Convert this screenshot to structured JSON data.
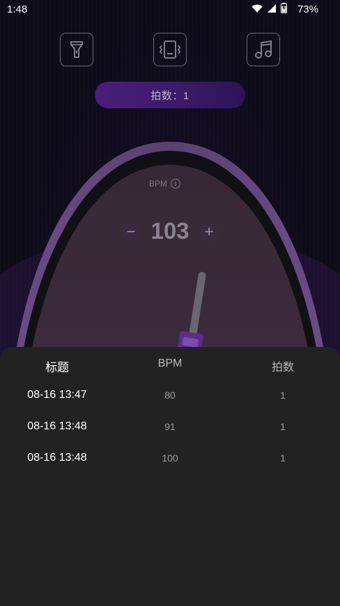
{
  "status_bar": {
    "time": "1:48",
    "battery": "73%",
    "icons": [
      "wifi-icon",
      "signal-icon",
      "battery-icon"
    ]
  },
  "toolbar": {
    "buttons": [
      {
        "name": "flashlight-button",
        "icon": "flashlight-icon"
      },
      {
        "name": "vibrate-button",
        "icon": "vibrate-icon"
      },
      {
        "name": "music-button",
        "icon": "music-note-icon"
      }
    ]
  },
  "beats_pill": {
    "label": "拍数：1"
  },
  "metronome": {
    "bpm_label": "BPM",
    "info_icon": "i",
    "minus_label": "−",
    "plus_label": "+",
    "bpm_value": "103"
  },
  "colors": {
    "accent_purple": "#4a1f7a",
    "sheet_bg": "#222222",
    "metronome_face": "#3b2a3c"
  },
  "history": {
    "headers": {
      "title": "标题",
      "bpm": "BPM",
      "beats": "拍数"
    },
    "rows": [
      {
        "title": "08-16 13:47",
        "bpm": "80",
        "beats": "1"
      },
      {
        "title": "08-16 13:48",
        "bpm": "91",
        "beats": "1"
      },
      {
        "title": "08-16 13:48",
        "bpm": "100",
        "beats": "1"
      }
    ]
  }
}
